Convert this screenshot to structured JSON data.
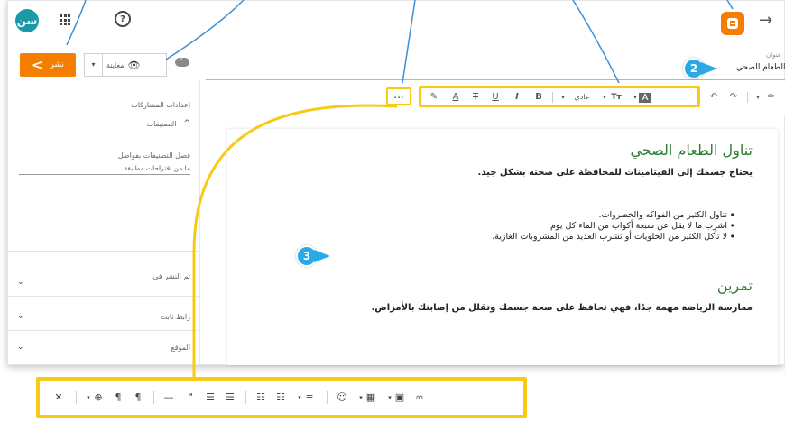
{
  "topbar": {
    "avatar_text": "سن",
    "apps_icon": "apps-grid-icon",
    "help_icon": "help-circle-icon",
    "logo": "blogger-logo",
    "back_icon": "arrow-right-icon"
  },
  "actions": {
    "publish_label": "نشر",
    "preview_label": "معاينة",
    "saved_icon": "cloud-check-icon"
  },
  "post": {
    "title_label": "عنوان",
    "title_value": "الطعام الصحي"
  },
  "sidebar": {
    "settings_label": "إعدادات المشاركات",
    "labels_section": "التصنيفات",
    "labels_hint": "فصل التصنيفات بفواصل",
    "labels_input": "ما من اقتراحات مطابقة",
    "published_on": "تم النشر في",
    "permalink": "رابط ثابت",
    "location": "الموقع"
  },
  "toolbar": {
    "undo_icon": "undo-icon",
    "redo_icon": "redo-icon",
    "pen_icon": "pen-icon",
    "block_format_label": "عادي",
    "font_size_label": "Tт",
    "bold_label": "B",
    "italic_label": "I",
    "underline_label": "U",
    "strike_label": "T",
    "text_color_label": "A",
    "more_label": "..."
  },
  "content": {
    "heading1": "تناول الطعام الصحي",
    "paragraph1": "يحتاج جسمك إلى الفيتامينات للمحافظة على صحته بشكل جيد.",
    "list_items": [
      "تناول الكثير من الفواكه والخضروات.",
      "اشرب ما لا يقل عن سبعة أكواب من الماء كل يوم.",
      "لا تأكل الكثير من الحلويات أو تشرب العديد من المشروبات الغازية."
    ],
    "heading2": "تمرين",
    "paragraph2": "ممارسة الرياضة مهمة جدًا، فهي تحافظ على صحة جسمك وتقلل من إصابتك بالأمراض."
  },
  "badges": {
    "badge2": "2",
    "badge3": "3"
  },
  "more_toolbar": {
    "link_icon": "link-icon",
    "image_icon": "image-icon",
    "video_icon": "video-icon",
    "emoji_icon": "emoji-icon",
    "align_icon": "align-icon",
    "numbered_list_icon": "numbered-list-icon",
    "bulleted_list_icon": "bulleted-list-icon",
    "quote_label": "\"",
    "hr_icon": "horizontal-rule-icon",
    "ltr_icon": "ltr-icon",
    "rtl_icon": "rtl-icon",
    "language_icon": "globe-icon",
    "clear_format_icon": "clear-formatting-icon"
  },
  "colors": {
    "accent_orange": "#f57d00",
    "highlight_yellow": "#f7ca18",
    "heading_green": "#2e7d32",
    "badge_blue": "#29a9e6",
    "callout_blue": "#3b8fd9"
  }
}
